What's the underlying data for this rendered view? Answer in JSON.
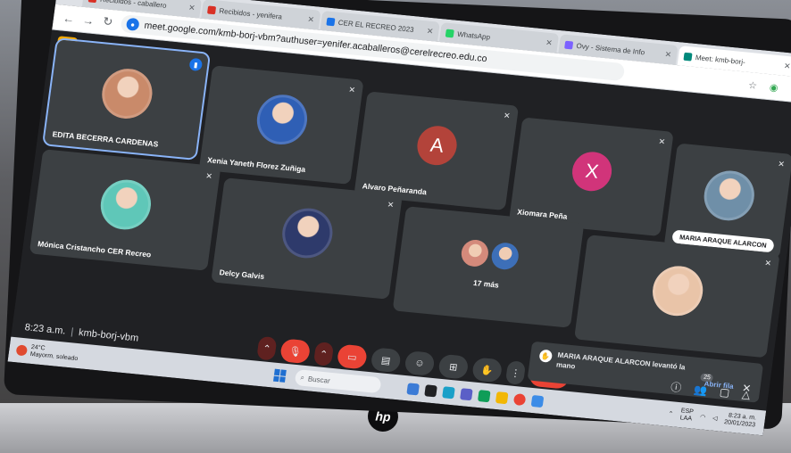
{
  "browser": {
    "tabs": [
      {
        "title": "Recibidos - caballero",
        "favicon": "gmail-icon",
        "color": "#d93025"
      },
      {
        "title": "Recibidos - yenifera",
        "favicon": "gmail-icon",
        "color": "#d93025"
      },
      {
        "title": "CER EL RECREO 2023",
        "favicon": "drive-icon",
        "color": "#1a73e8"
      },
      {
        "title": "WhatsApp",
        "favicon": "whatsapp-icon",
        "color": "#25d366"
      },
      {
        "title": "Ovy - Sistema de Info",
        "favicon": "ovy-icon",
        "color": "#7b61ff"
      },
      {
        "title": "Meet: kmb-borj-",
        "favicon": "meet-icon",
        "color": "#00897b",
        "active": true
      }
    ],
    "new_tab": "+",
    "url": "meet.google.com/kmb-borj-vbm?authuser=yenifer.acaballeros@cerelrecreo.edu.co"
  },
  "meet": {
    "participants": [
      {
        "name": "EDITA BECERRA CARDENAS",
        "kind": "photo",
        "color": "#c98a6a",
        "speaking": true
      },
      {
        "name": "Xenia Yaneth Florez Zuñiga",
        "kind": "photo",
        "color": "#2f5fb5",
        "muted": true
      },
      {
        "name": "Alvaro Peñaranda",
        "kind": "letter",
        "letter": "A",
        "color": "#b3433a",
        "muted": true
      },
      {
        "name": "Xiomara Peña",
        "kind": "letter",
        "letter": "X",
        "color": "#d1347a",
        "muted": true
      },
      {
        "name": "MARIA ARAQUE ALARCON",
        "kind": "photo",
        "color": "#6f8fa8",
        "muted": true,
        "hand_raised": true
      },
      {
        "name": "Mónica Cristancho CER Recreo",
        "kind": "photo",
        "color": "#5fc7b8",
        "muted": true
      },
      {
        "name": "Delcy Galvis",
        "kind": "photo",
        "color": "#2e3a6b",
        "muted": true
      },
      {
        "name": "17 más",
        "kind": "more"
      },
      {
        "name": "",
        "kind": "photo",
        "color": "#e9c4a8",
        "muted": true
      }
    ],
    "time": "8:23 a.m.",
    "meeting_code": "kmb-borj-vbm",
    "toast": {
      "message": "MARIA ARAQUE ALARCON levantó la mano",
      "action": "Abrir fila"
    },
    "people_count": "25"
  },
  "taskbar": {
    "weather_temp": "24°C",
    "weather_desc": "Mayorm. soleado",
    "search": "Buscar",
    "lang": "ESP",
    "lang_sub": "LAA",
    "clock_time": "8:23 a. m.",
    "clock_date": "20/01/2023"
  },
  "laptop": {
    "brand": "hp"
  }
}
